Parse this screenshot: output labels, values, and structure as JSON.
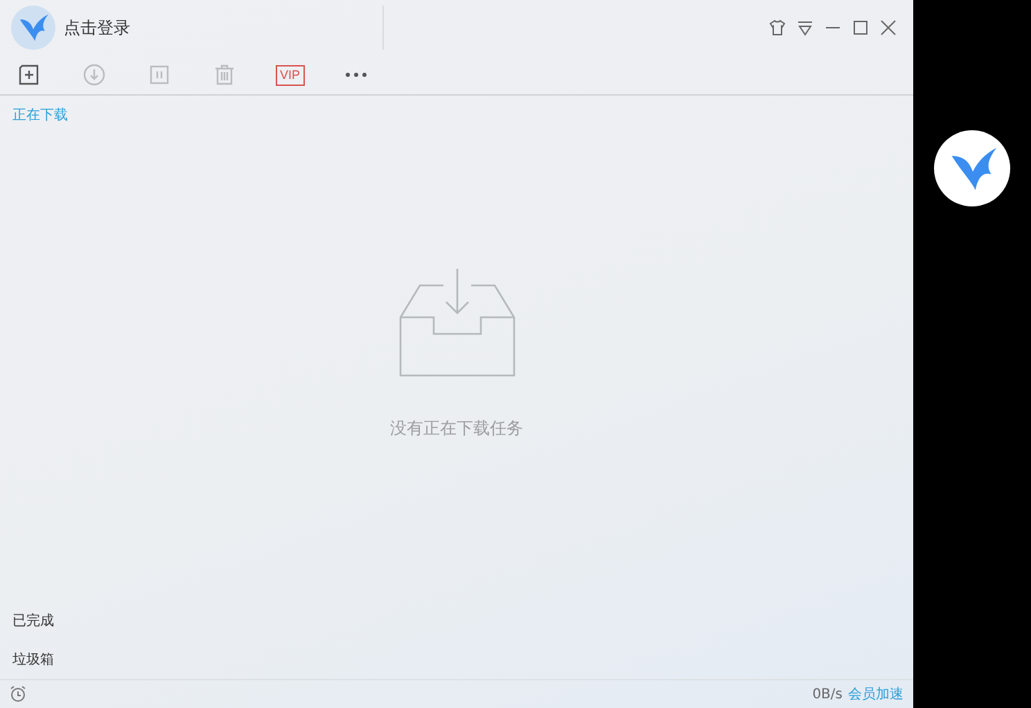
{
  "header": {
    "login": "点击登录"
  },
  "toolbar": [
    {
      "kind": "new",
      "disabled": false
    },
    {
      "kind": "start",
      "disabled": true
    },
    {
      "kind": "pause",
      "disabled": true
    },
    {
      "kind": "delete",
      "disabled": true
    },
    {
      "kind": "vip",
      "label": "VIP",
      "disabled": false
    },
    {
      "kind": "more",
      "disabled": false
    }
  ],
  "nav_top": [
    {
      "label": "正在下载",
      "selected": true
    }
  ],
  "empty_state": {
    "message": "没有正在下载任务"
  },
  "nav_bottom": [
    {
      "label": "已完成",
      "selected": false
    },
    {
      "label": "垃圾箱",
      "selected": false
    }
  ],
  "status_bar": {
    "speed": "0B/s",
    "link": "会员加速"
  }
}
